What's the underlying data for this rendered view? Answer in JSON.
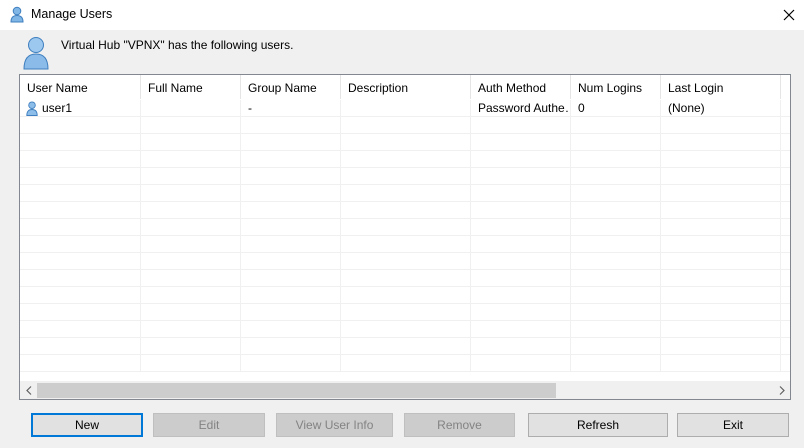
{
  "window": {
    "title": "Manage Users",
    "close_icon": "close-icon",
    "user_icon": "user-icon"
  },
  "header": {
    "message": "Virtual Hub \"VPNX\" has the following users."
  },
  "table": {
    "columns": [
      "User Name",
      "Full Name",
      "Group Name",
      "Description",
      "Auth Method",
      "Num Logins",
      "Last Login"
    ],
    "rows": [
      [
        "user1",
        "",
        "-",
        "",
        "Password Authe…",
        "0",
        "(None)"
      ]
    ]
  },
  "buttons": {
    "new": "New",
    "edit": "Edit",
    "view_user_info": "View User Info",
    "remove": "Remove",
    "refresh": "Refresh",
    "exit": "Exit"
  },
  "colors": {
    "focus_border": "#0078d7",
    "icon_blue": "#6aa7dc"
  }
}
